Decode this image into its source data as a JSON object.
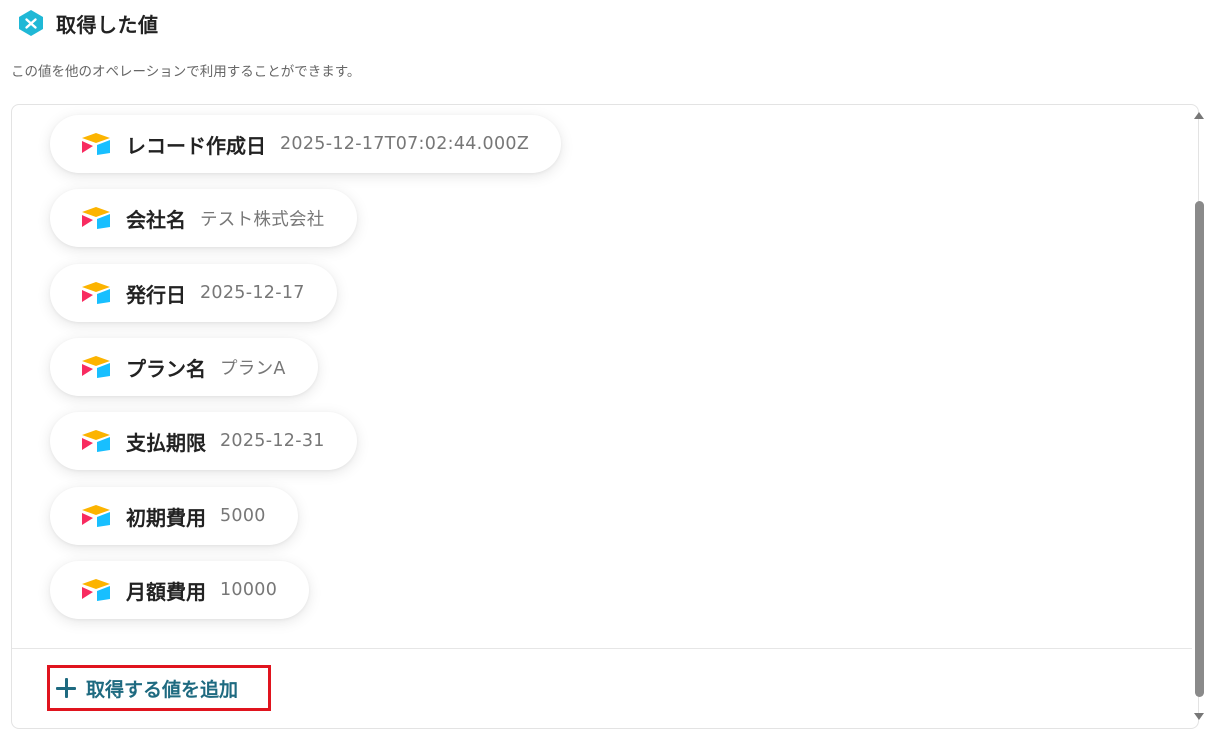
{
  "header": {
    "title": "取得した値",
    "description": "この値を他のオペレーションで利用することができます。"
  },
  "fields": [
    {
      "name": "レコード作成日",
      "value": "2025-12-17T07:02:44.000Z"
    },
    {
      "name": "会社名",
      "value": "テスト株式会社"
    },
    {
      "name": "発行日",
      "value": "2025-12-17"
    },
    {
      "name": "プラン名",
      "value": "プランA"
    },
    {
      "name": "支払期限",
      "value": "2025-12-31"
    },
    {
      "name": "初期費用",
      "value": "5000"
    },
    {
      "name": "月額費用",
      "value": "10000"
    }
  ],
  "actions": {
    "add_label": "取得する値を追加"
  },
  "colors": {
    "accent": "#1e6a80",
    "highlight_border": "#e0141e",
    "badge": "#1fb8d6"
  },
  "icons": {
    "header_badge": "x-icon",
    "field_app": "airtable-icon",
    "add": "plus-icon"
  }
}
